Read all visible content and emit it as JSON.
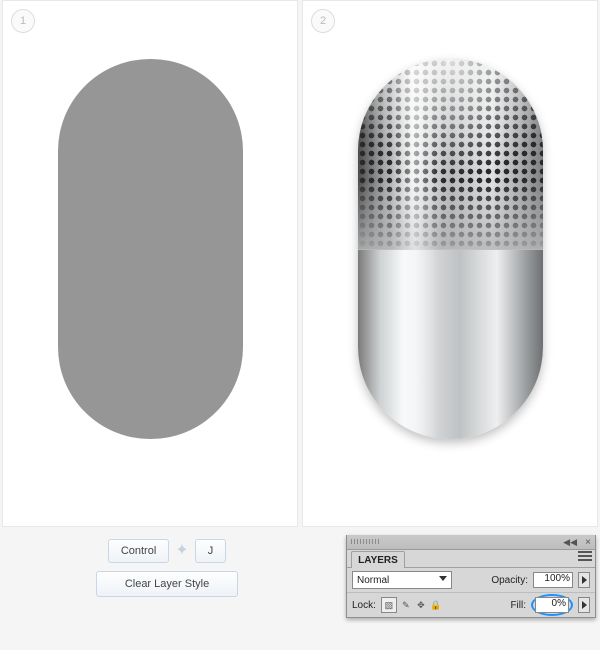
{
  "steps": {
    "one": "1",
    "two": "2"
  },
  "controls": {
    "key_control": "Control",
    "key_j": "J",
    "clear_layer_style": "Clear Layer Style"
  },
  "layers_panel": {
    "tab": "LAYERS",
    "blend_mode": "Normal",
    "opacity_label": "Opacity:",
    "opacity_value": "100%",
    "lock_label": "Lock:",
    "fill_label": "Fill:",
    "fill_value": "0%",
    "collapse_glyph": "◀◀",
    "close_glyph": "×",
    "lock_move_glyph": "✥",
    "lock_all_glyph": "🔒",
    "lock_paint_glyph": "✎"
  }
}
